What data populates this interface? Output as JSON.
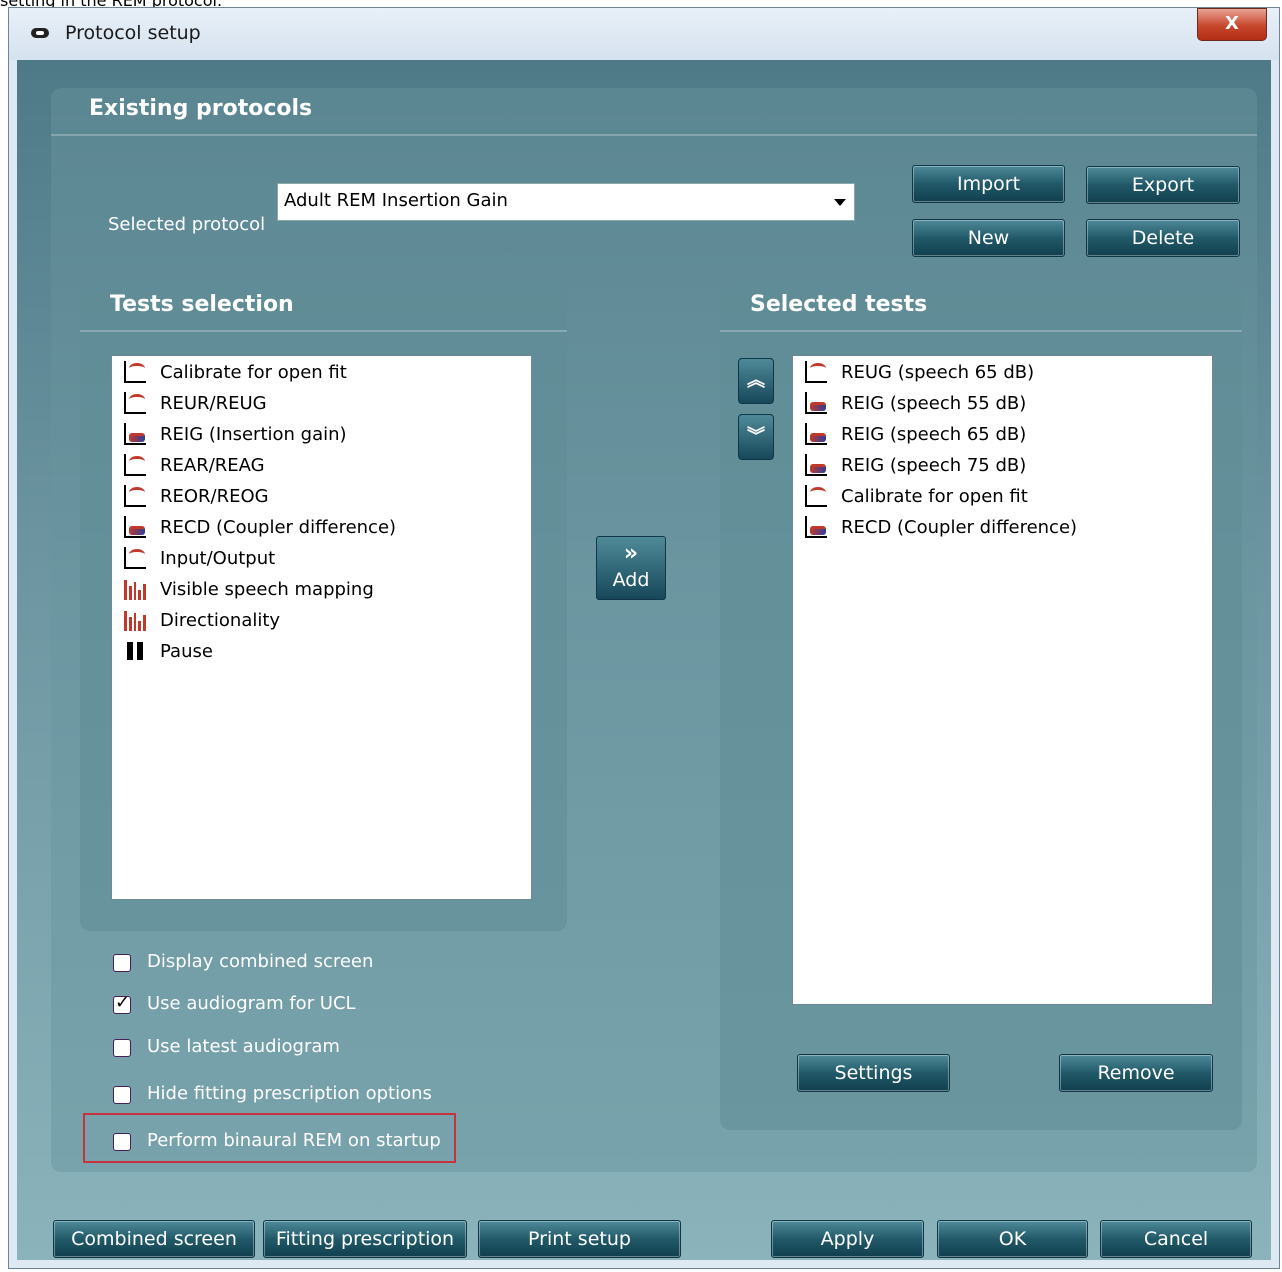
{
  "caption": "setting in the REM protocol.",
  "window": {
    "title": "Protocol setup",
    "close_label": "X"
  },
  "existing": {
    "title": "Existing protocols",
    "selected_label": "Selected protocol",
    "selected_value": "Adult REM Insertion Gain",
    "buttons": {
      "import": "Import",
      "export": "Export",
      "new": "New",
      "delete": "Delete"
    }
  },
  "tests_selection": {
    "title": "Tests selection",
    "items": [
      {
        "label": "Calibrate for open fit",
        "icon": "curve-icon"
      },
      {
        "label": "REUR/REUG",
        "icon": "curve-icon"
      },
      {
        "label": "REIG (Insertion gain)",
        "icon": "gain-curve-icon"
      },
      {
        "label": "REAR/REAG",
        "icon": "curve-icon"
      },
      {
        "label": "REOR/REOG",
        "icon": "curve-icon"
      },
      {
        "label": "RECD (Coupler difference)",
        "icon": "coupler-curve-icon"
      },
      {
        "label": "Input/Output",
        "icon": "io-curve-icon"
      },
      {
        "label": "Visible speech mapping",
        "icon": "bar-chart-icon"
      },
      {
        "label": "Directionality",
        "icon": "bar-chart-icon"
      },
      {
        "label": "Pause",
        "icon": "pause-icon"
      }
    ]
  },
  "add_button": {
    "arrow": "»",
    "label": "Add"
  },
  "selected_tests": {
    "title": "Selected tests",
    "items": [
      {
        "label": "REUG (speech 65 dB)",
        "icon": "curve-icon"
      },
      {
        "label": "REIG (speech 55 dB)",
        "icon": "gain-curve-icon"
      },
      {
        "label": "REIG (speech 65 dB)",
        "icon": "gain-curve-icon"
      },
      {
        "label": "REIG (speech 75 dB)",
        "icon": "gain-curve-icon"
      },
      {
        "label": "Calibrate for open fit",
        "icon": "curve-icon"
      },
      {
        "label": "RECD (Coupler difference)",
        "icon": "coupler-curve-icon"
      }
    ],
    "settings": "Settings",
    "remove": "Remove"
  },
  "options": [
    {
      "label": "Display combined screen",
      "checked": false
    },
    {
      "label": "Use audiogram for UCL",
      "checked": true
    },
    {
      "label": "Use latest audiogram",
      "checked": false
    },
    {
      "label": "Hide fitting prescription options",
      "checked": false
    },
    {
      "label": "Perform binaural REM on startup",
      "checked": false
    }
  ],
  "footer": {
    "combined_screen": "Combined screen",
    "fitting_prescription": "Fitting prescription",
    "print_setup": "Print setup",
    "apply": "Apply",
    "ok": "OK",
    "cancel": "Cancel"
  }
}
